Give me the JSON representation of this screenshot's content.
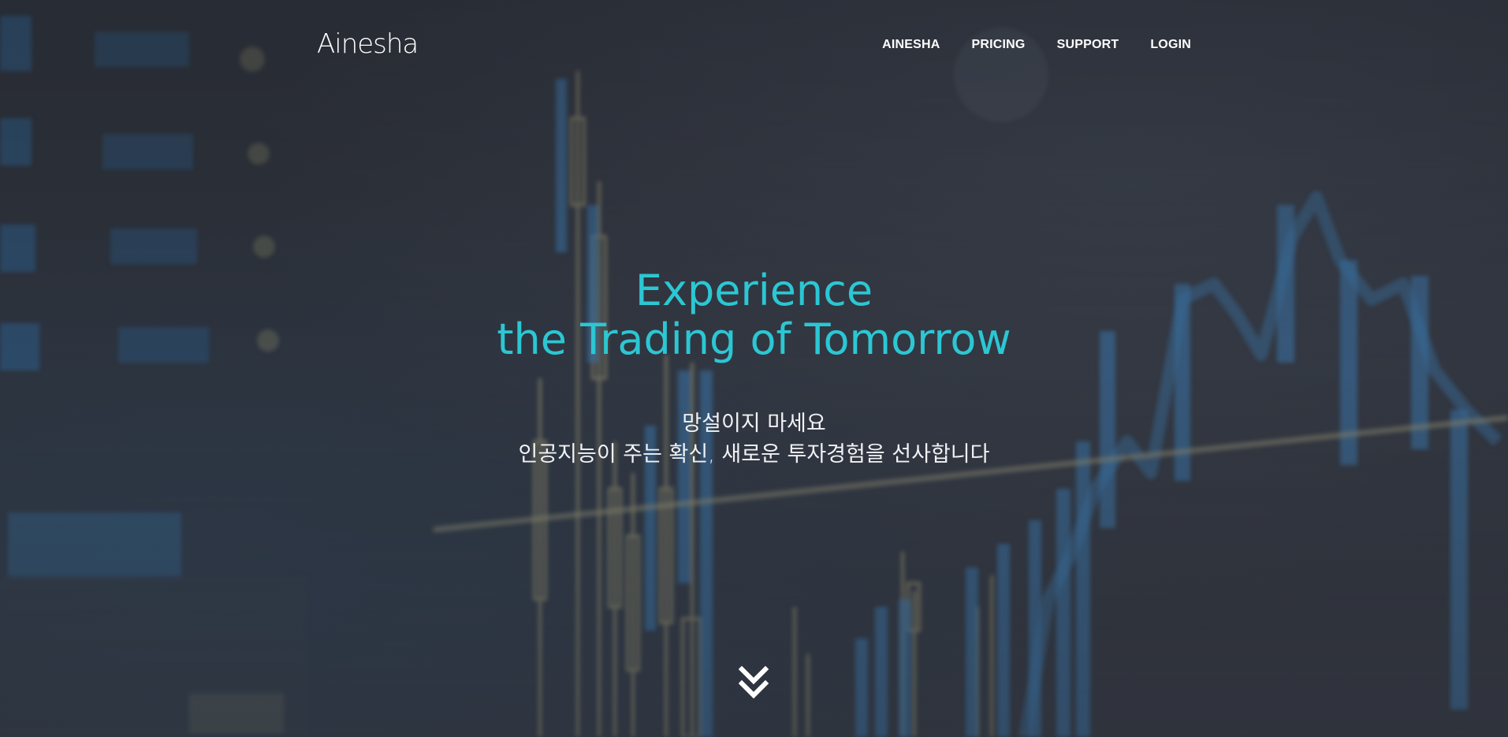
{
  "brand": {
    "logo_text": "Ainesha"
  },
  "nav": {
    "items": [
      {
        "label": "AINESHA"
      },
      {
        "label": "PRICING"
      },
      {
        "label": "SUPPORT"
      },
      {
        "label": "LOGIN"
      }
    ]
  },
  "hero": {
    "headline_line1": "Experience",
    "headline_line2": "the Trading of Tomorrow",
    "sub_line1": "망설이지 마세요",
    "sub_line2": "인공지능이 주는 확신, 새로운 투자경험을 선사합니다",
    "scroll_icon": "double-chevron-down-icon"
  },
  "colors": {
    "accent": "#2bc7d3",
    "text": "#ffffff",
    "background": "#2b2f38"
  }
}
